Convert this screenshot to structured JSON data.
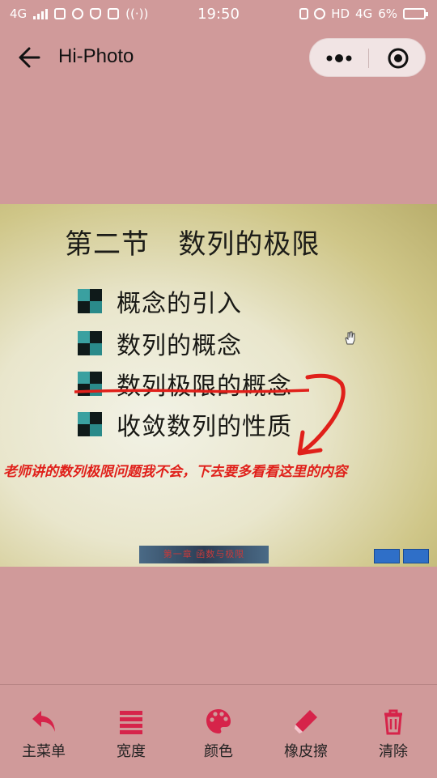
{
  "status_bar": {
    "network_left": "4G",
    "time": "19:50",
    "hd": "HD",
    "network_right": "4G",
    "battery_percent": "6%"
  },
  "header": {
    "title": "Hi-Photo"
  },
  "photo": {
    "slide_title": "第二节   数列的极限",
    "bullets": [
      "概念的引入",
      "数列的概念",
      "数列极限的概念",
      "收敛数列的性质"
    ],
    "annotation": "老师讲的数列极限问题我不会，下去要多看看这里的内容",
    "footer_text": "第一章  函数与极限"
  },
  "toolbar": {
    "items": [
      {
        "label": "主菜单",
        "icon": "undo-arrow-icon"
      },
      {
        "label": "宽度",
        "icon": "lines-width-icon"
      },
      {
        "label": "颜色",
        "icon": "palette-icon"
      },
      {
        "label": "橡皮擦",
        "icon": "eraser-icon"
      },
      {
        "label": "清除",
        "icon": "trash-icon"
      }
    ],
    "accent_color": "#d6244a"
  },
  "colors": {
    "background": "#d09a9a",
    "annotation": "#e0201a"
  }
}
